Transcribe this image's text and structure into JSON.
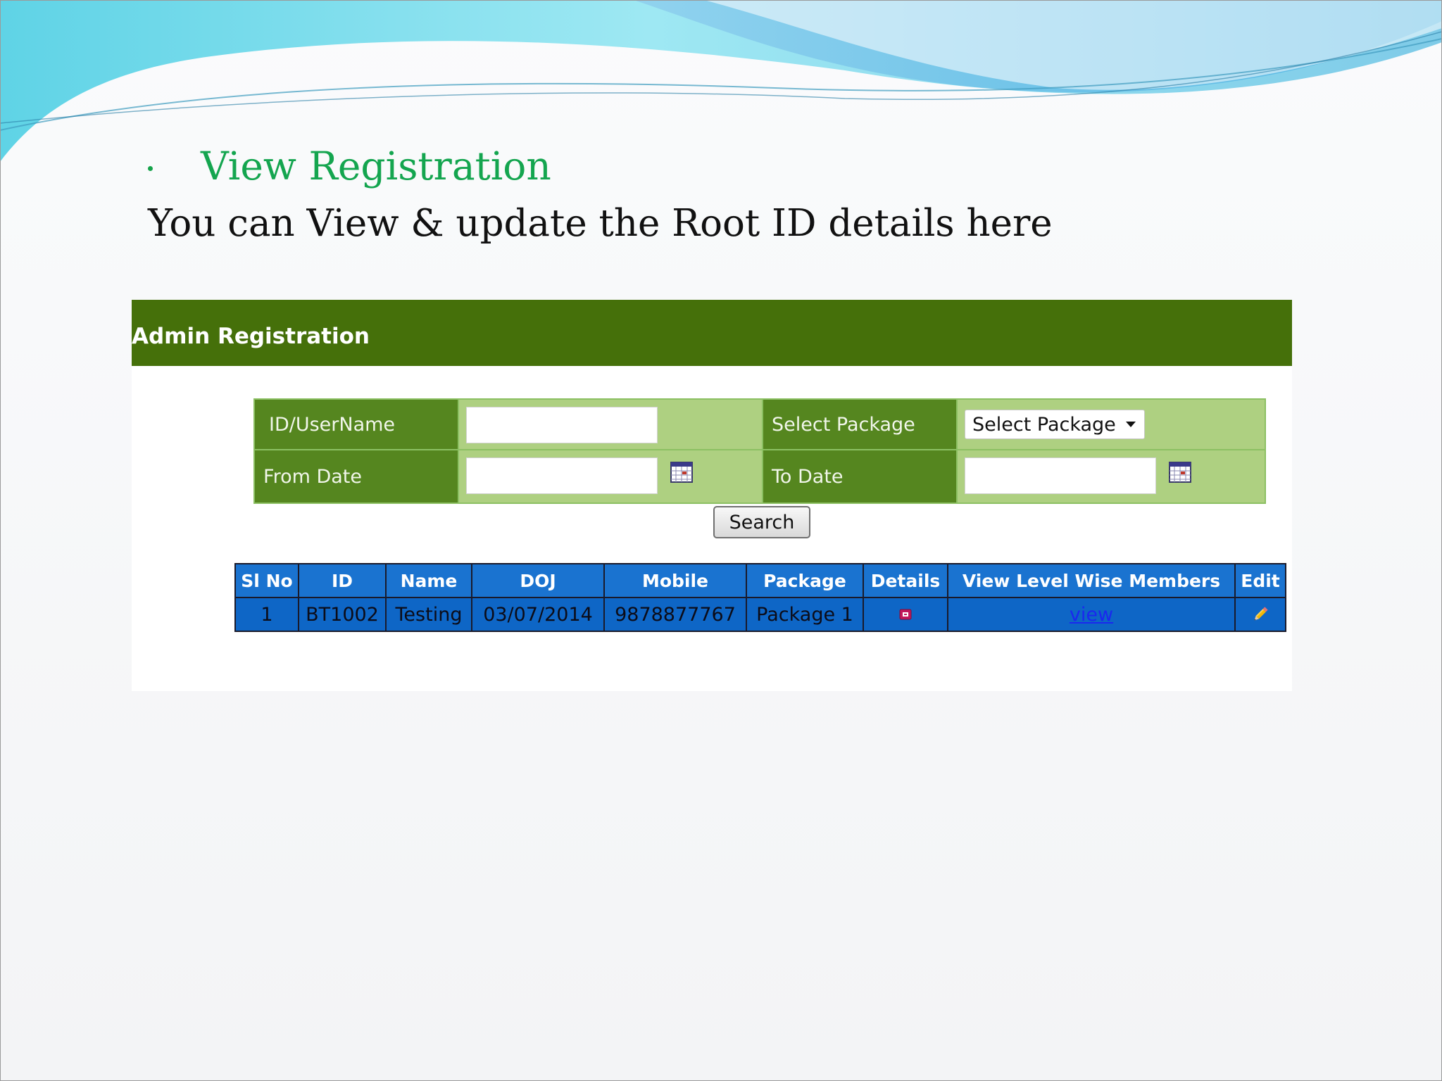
{
  "slide": {
    "heading": "View Registration",
    "subtitle": "You can View & update the Root ID details here"
  },
  "panel": {
    "title": "Admin Registration",
    "form": {
      "id_label": "ID/UserName",
      "id_value": "",
      "package_label": "Select Package",
      "package_selected": "Select Package",
      "from_label": "From Date",
      "from_value": "",
      "to_label": "To Date",
      "to_value": ""
    },
    "search_label": "Search",
    "table": {
      "headers": [
        "Sl No",
        "ID",
        "Name",
        "DOJ",
        "Mobile",
        "Package",
        "Details",
        "View Level Wise Members",
        "Edit"
      ],
      "rows": [
        {
          "sl_no": "1",
          "id": "BT1002",
          "name": "Testing",
          "doj": "03/07/2014",
          "mobile": "9878877767",
          "package": "Package 1",
          "details_icon": "details-icon",
          "view_link": "view",
          "edit_icon": "pencil-icon"
        }
      ]
    }
  },
  "colors": {
    "heading": "#14a54f",
    "panel_header": "#45700a",
    "form_label_bg": "#55861f",
    "form_value_bg": "#aed081",
    "table_bg": "#0e66c6",
    "link": "#1a28ee"
  }
}
